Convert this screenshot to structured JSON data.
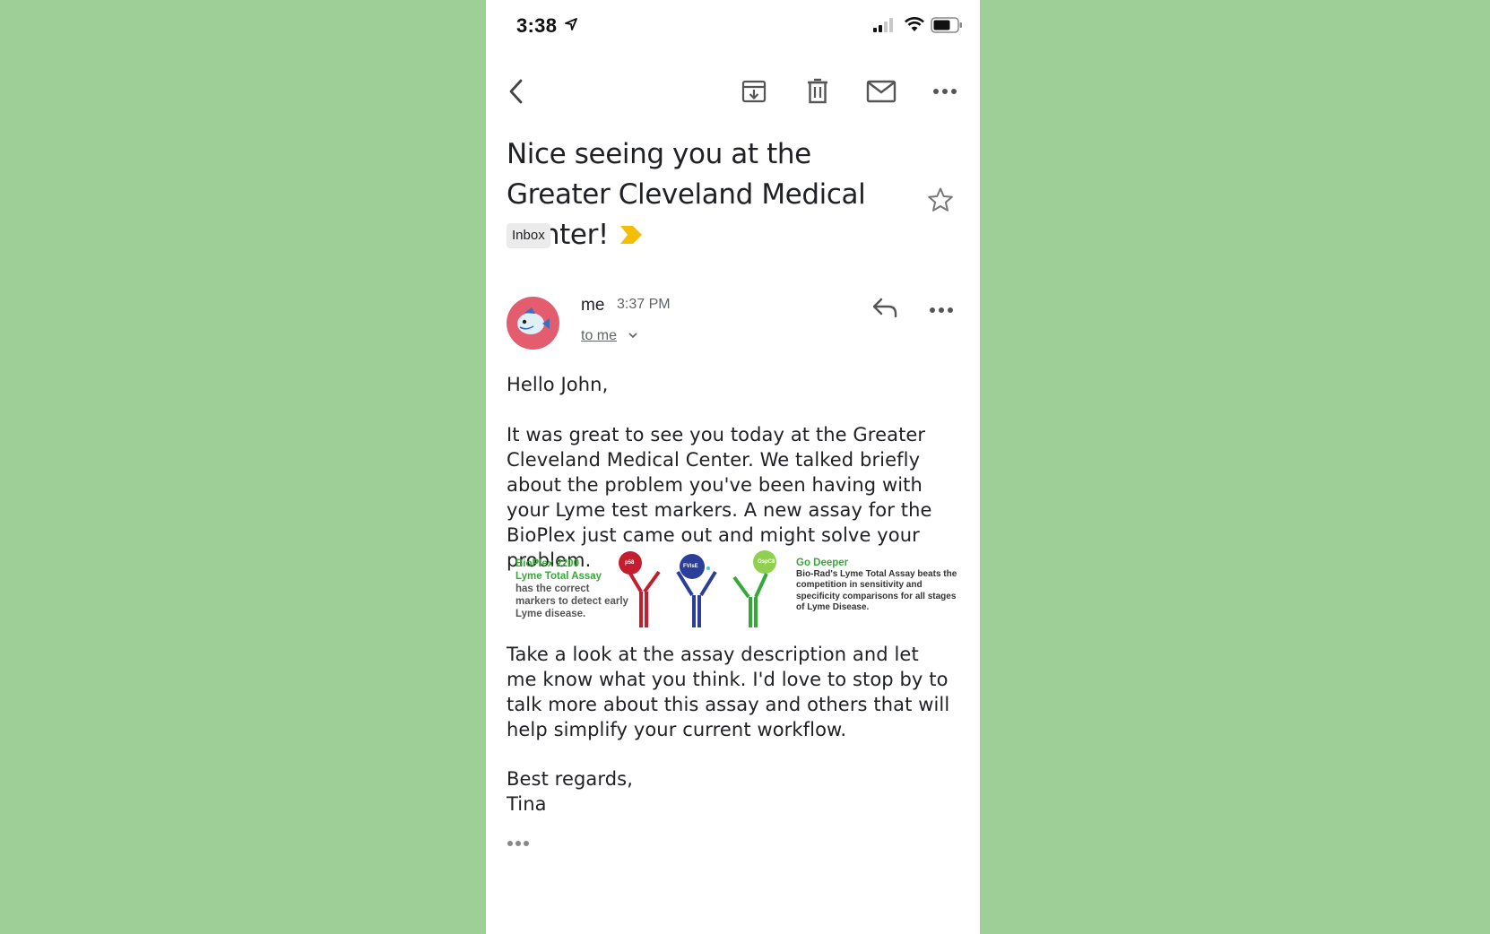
{
  "status_bar": {
    "time": "3:38"
  },
  "toolbar": {
    "back_icon": "chevron-left-icon",
    "archive_icon": "archive-icon",
    "delete_icon": "trash-icon",
    "mark_unread_icon": "mail-icon",
    "more_icon": "more-horizontal-icon"
  },
  "email": {
    "subject": "Nice seeing you at the Greater Cleveland Medical Center!",
    "label": "Inbox",
    "sender": "me",
    "time": "3:37 PM",
    "recipient": "to me",
    "greeting": "Hello John,",
    "paragraph1": "It was great to see you today at the Greater Cleveland Medical Center. We talked briefly about the problem you've been having with your Lyme test markers. A new assay for the BioPlex just came out and might solve your problem.",
    "paragraph2": "Take a look at the assay description and let me know what you think. I'd love to stop by to talk more about this assay and others that will help simplify your current workflow.",
    "closing": "Best regards,",
    "signature": "Tina"
  },
  "promo": {
    "left_title1": "BioPlex 2200",
    "left_title2": "Lyme Total Assay",
    "left_text": "has the correct markers to detect early Lyme disease.",
    "right_title": "Go Deeper",
    "right_text": "Bio-Rad's Lyme Total Assay beats the competition in sensitivity and specificity comparisons for all stages of Lyme Disease.",
    "ball1": "p58",
    "ball2": "FVlsE",
    "ball3": "OspC8"
  },
  "colors": {
    "background": "#9dcf96",
    "avatar": "#e35d6e",
    "importance": "#f2be07",
    "promo_green": "#3aa83a"
  }
}
